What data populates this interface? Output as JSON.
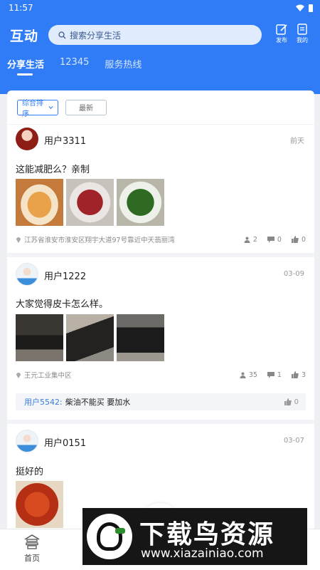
{
  "status": {
    "time": "11:57"
  },
  "header": {
    "title": "互动",
    "search_placeholder": "搜索分享生活",
    "publish_label": "发布",
    "mine_label": "我的"
  },
  "tabs": [
    "分享生活",
    "12345",
    "服务热线"
  ],
  "sort": {
    "sort_label": "综合排序",
    "latest_label": "最新"
  },
  "posts": [
    {
      "user": "用户3311",
      "date": "前天",
      "text": "这能减肥么？亲制",
      "location": "江苏省淮安市淮安区翔宇大道97号靠近中天翡丽湾",
      "views": "2",
      "comments": "0",
      "likes": "0"
    },
    {
      "user": "用户1222",
      "date": "03-09",
      "text": "大家觉得皮卡怎么样。",
      "location": "王元工业集中区",
      "views": "35",
      "comments": "1",
      "likes": "3",
      "comment": {
        "user": "用户5542:",
        "text": "柴油不能买   要加水",
        "likes": "0"
      }
    },
    {
      "user": "用户0151",
      "date": "03-07",
      "text": "挺好的"
    }
  ],
  "bottom_nav": {
    "home_label": "首页"
  },
  "watermark": {
    "title": "下载鸟资源",
    "url": "www.xiazainiao.com"
  },
  "colors": {
    "primary": "#2f7cf6",
    "link": "#3b7dd8"
  }
}
